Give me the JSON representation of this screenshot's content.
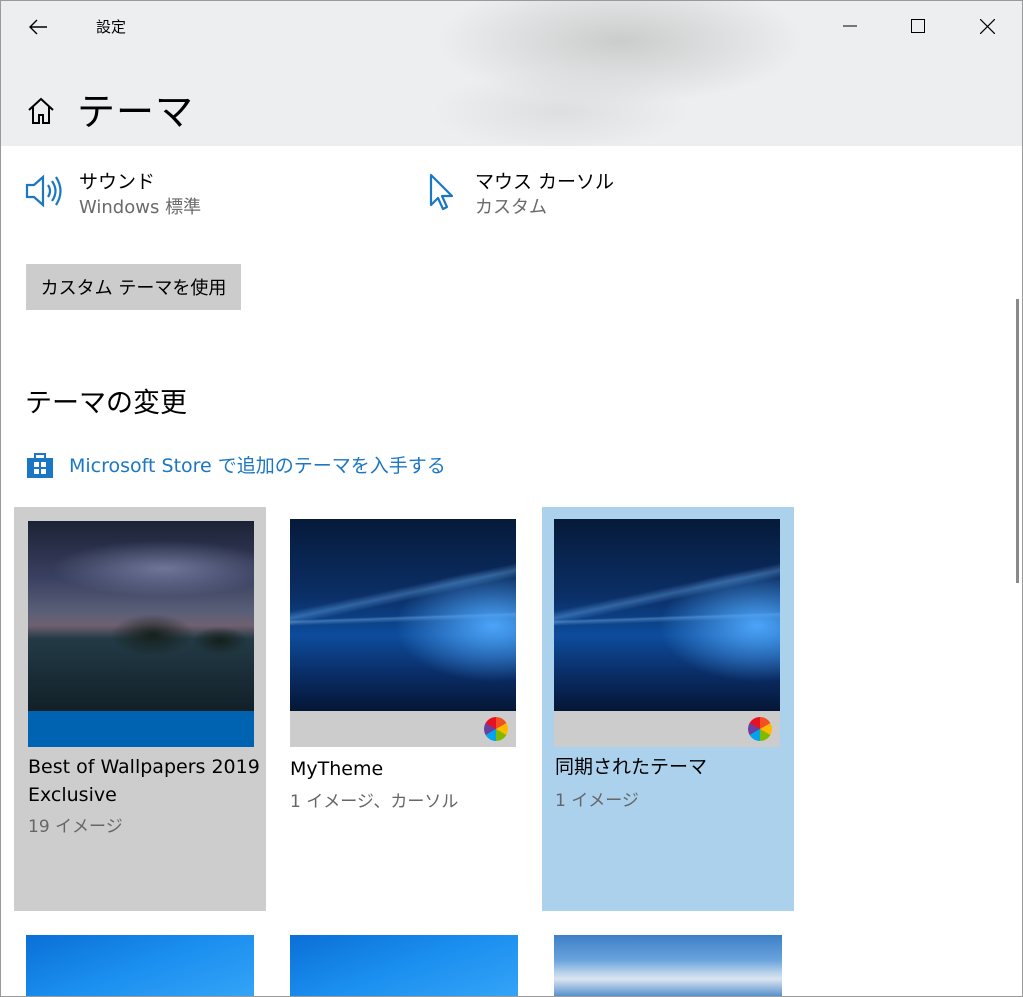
{
  "window": {
    "app_title": "設定",
    "page_title": "テーマ"
  },
  "settings": {
    "sound": {
      "title": "サウンド",
      "value": "Windows 標準"
    },
    "mouse_cursor": {
      "title": "マウス カーソル",
      "value": "カスタム"
    }
  },
  "custom_theme_button": "カスタム テーマを使用",
  "change_section": {
    "title": "テーマの変更",
    "store_link": "Microsoft Store で追加のテーマを入手する"
  },
  "themes": [
    {
      "name": "Best of Wallpapers 2019 Exclusive",
      "sub": "19 イメージ",
      "state": "hover"
    },
    {
      "name": "MyTheme",
      "sub": "1 イメージ、カーソル",
      "state": "normal"
    },
    {
      "name": "同期されたテーマ",
      "sub": "1 イメージ",
      "state": "selected"
    }
  ],
  "colors": {
    "accent": "#1b77c4",
    "selected_tile": "#abd1ec",
    "hover_tile": "#cdcdcd",
    "theme1_bar": "#0063b1"
  },
  "icons": {
    "back": "back-arrow-icon",
    "minimize": "minimize-icon",
    "maximize": "maximize-icon",
    "close": "close-icon",
    "home": "home-icon",
    "sound": "speaker-icon",
    "cursor": "mouse-pointer-icon",
    "store": "store-bag-icon",
    "color": "color-wheel-icon"
  }
}
